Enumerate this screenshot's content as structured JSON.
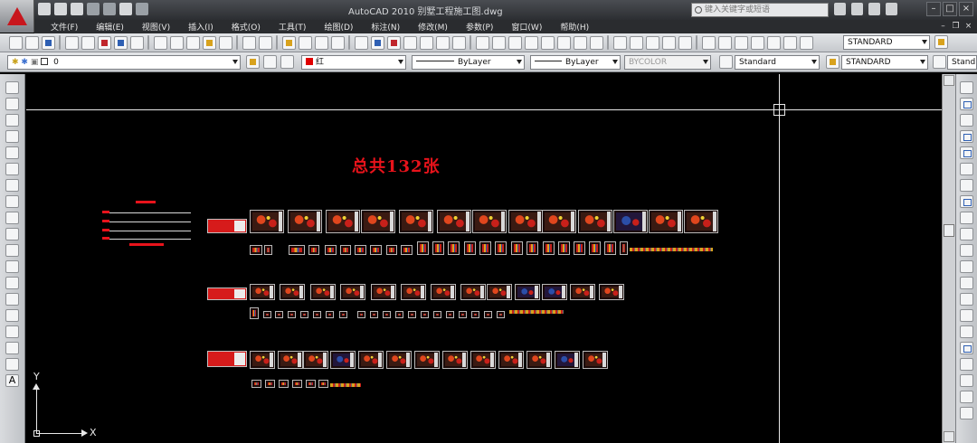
{
  "app": {
    "title": "AutoCAD 2010    别墅工程施工图.dwg"
  },
  "search": {
    "placeholder": "键入关键字或短语"
  },
  "menu": [
    "文件(F)",
    "编辑(E)",
    "视图(V)",
    "插入(I)",
    "格式(O)",
    "工具(T)",
    "绘图(D)",
    "标注(N)",
    "修改(M)",
    "参数(P)",
    "窗口(W)",
    "帮助(H)"
  ],
  "toolbar": {
    "text_style": "STANDARD",
    "layer": "0",
    "color": "红",
    "linetype": "ByLayer",
    "lineweight": "ByLayer",
    "plot_style": "BYCOLOR",
    "text_style2": "Standard",
    "dim_style": "STANDARD",
    "table_style": "Stand"
  },
  "drawing": {
    "title": "总共132张"
  },
  "ucs": {
    "x_label": "X",
    "y_label": "Y"
  },
  "colors": {
    "accent_red": "#e8131b",
    "background": "#000000"
  }
}
